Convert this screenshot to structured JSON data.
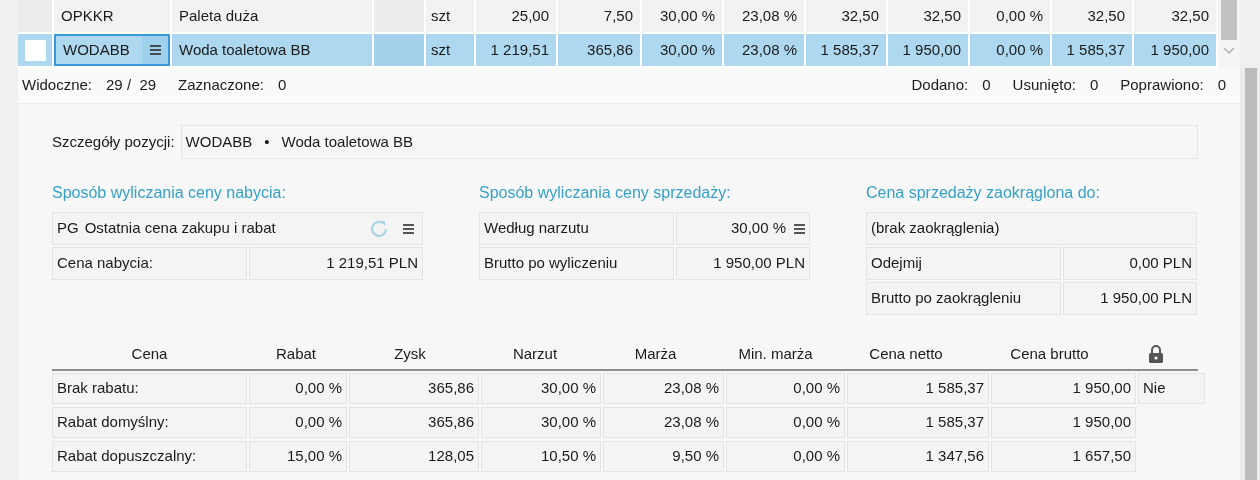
{
  "grid": {
    "rows": [
      {
        "selected": false,
        "code": "OPKKR",
        "name": "Paleta duża",
        "unit": "szt",
        "values": [
          "25,00",
          "7,50",
          "30,00 %",
          "23,08 %",
          "32,50",
          "32,50",
          "0,00 %",
          "32,50",
          "32,50"
        ]
      },
      {
        "selected": true,
        "code": "WODABB",
        "name": "Woda toaletowa BB",
        "unit": "szt",
        "values": [
          "1 219,51",
          "365,86",
          "30,00 %",
          "23,08 %",
          "1 585,37",
          "1 950,00",
          "0,00 %",
          "1 585,37",
          "1 950,00"
        ]
      }
    ]
  },
  "status_bar": {
    "left": [
      {
        "label": "Widoczne:",
        "value": "29 /  29"
      },
      {
        "label": "Zaznaczone:",
        "value": "0"
      }
    ],
    "right": [
      {
        "label": "Dodano:",
        "value": "0"
      },
      {
        "label": "Usunięto:",
        "value": "0"
      },
      {
        "label": "Poprawiono:",
        "value": "0"
      }
    ]
  },
  "details": {
    "label": "Szczegóły pozycji:",
    "code": "WODABB",
    "separator": "•",
    "name": "Woda toaletowa BB"
  },
  "purchase": {
    "title": "Sposób wyliczania ceny nabycia:",
    "method_code": "PG",
    "method": "Ostatnia cena zakupu i rabat",
    "rows": [
      {
        "label": "Cena nabycia:",
        "value": "1 219,51 PLN"
      }
    ]
  },
  "sale": {
    "title": "Sposób wyliczania ceny sprzedaży:",
    "method": "Według narzutu",
    "method_value": "30,00 %",
    "rows": [
      {
        "label": "Brutto po wyliczeniu",
        "value": "1 950,00 PLN"
      }
    ]
  },
  "rounding": {
    "title": "Cena sprzedaży zaokrąglona do:",
    "mode": "(brak zaokrąglenia)",
    "rows": [
      {
        "label": "Odejmij",
        "value": "0,00 PLN"
      },
      {
        "label": "Brutto po zaokrągleniu",
        "value": "1 950,00 PLN"
      }
    ]
  },
  "price_table": {
    "columns": [
      "Cena",
      "Rabat",
      "Zysk",
      "Narzut",
      "Marża",
      "Min. marża",
      "Cena netto",
      "Cena brutto"
    ],
    "rows": [
      {
        "cells": [
          "Brak rabatu:",
          "0,00 %",
          "365,86",
          "30,00 %",
          "23,08 %",
          "0,00 %",
          "1 585,37",
          "1 950,00"
        ],
        "locked": "Nie"
      },
      {
        "cells": [
          "Rabat domyślny:",
          "0,00 %",
          "365,86",
          "30,00 %",
          "23,08 %",
          "0,00 %",
          "1 585,37",
          "1 950,00"
        ]
      },
      {
        "cells": [
          "Rabat dopuszczalny:",
          "15,00 %",
          "128,05",
          "10,50 %",
          "9,50 %",
          "0,00 %",
          "1 347,56",
          "1 657,50"
        ]
      }
    ]
  }
}
